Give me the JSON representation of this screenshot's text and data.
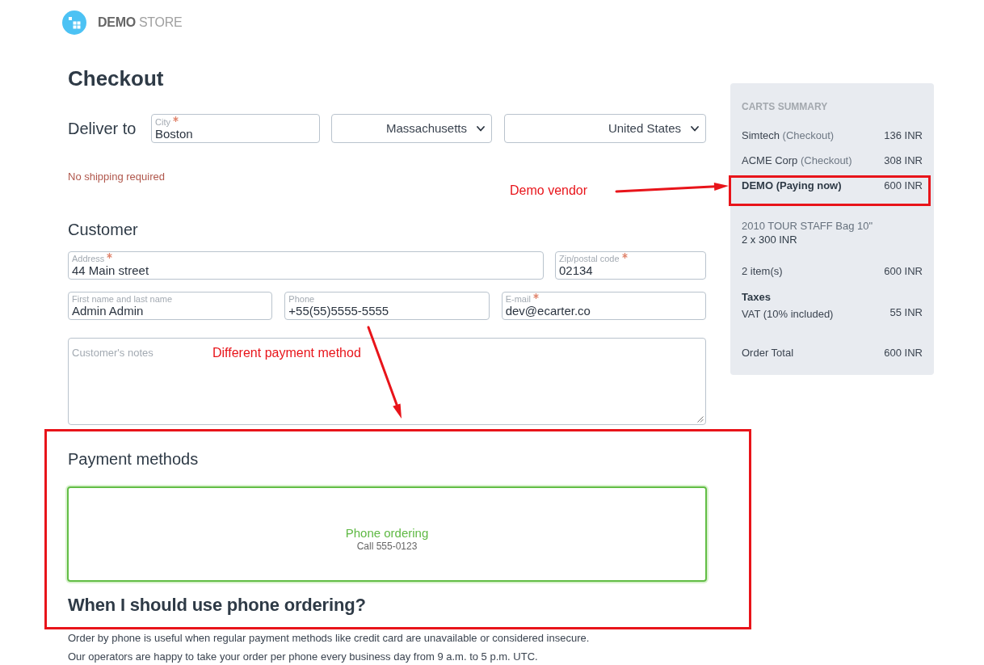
{
  "header": {
    "logo_text": "**DEMO** STORE"
  },
  "page_title": "Checkout",
  "delivery": {
    "label": "Deliver to",
    "city": {
      "label": "City",
      "required": true,
      "value": "Boston"
    },
    "state": {
      "value": "Massachusetts"
    },
    "country": {
      "value": "United States"
    },
    "shipping_note": "No shipping required"
  },
  "customer": {
    "title": "Customer",
    "rows": [
      [
        {
          "label": "Address",
          "required": true,
          "value": "44 Main street"
        },
        {
          "label": "Zip/postal code",
          "required": true,
          "value": "02134"
        }
      ],
      [
        {
          "label": "First name and last name",
          "required": false,
          "value": "Admin Admin"
        },
        {
          "label": "Phone",
          "required": false,
          "value": "+55(55)5555-5555"
        },
        {
          "label": "E-mail",
          "required": true,
          "value": "dev@ecarter.co"
        }
      ]
    ],
    "notes": {
      "placeholder": "Customer's notes"
    }
  },
  "payment": {
    "title": "Payment methods",
    "methods": [
      {
        "name": "Phone ordering",
        "description": "Call 555-0123",
        "selected": true
      }
    ],
    "info_title": "When I should use phone ordering?",
    "info_paragraphs": [
      "Order by phone is useful when regular payment methods like credit card are unavailable or considered insecure.",
      "Our operators are happy to take your order per phone every business day from 9 a.m. to 5 p.m. UTC."
    ]
  },
  "carts_summary": {
    "title": "CARTS SUMMARY",
    "vendors": [
      {
        "name": "Simtech",
        "status": "(Checkout)",
        "total": "136 INR",
        "selected": false
      },
      {
        "name": "ACME Corp",
        "status": "(Checkout)",
        "total": "308 INR",
        "selected": false
      },
      {
        "name": "DEMO",
        "status": "(Paying now)",
        "total": "600 INR",
        "selected": true
      }
    ],
    "items": [
      {
        "name": "2010 TOUR STAFF Bag 10\"",
        "quantity_price": "2 x 300 INR"
      }
    ],
    "subtotal": {
      "label": "2 item(s)",
      "value": "600 INR"
    },
    "taxes": {
      "title": "Taxes",
      "rows": [
        {
          "label": "VAT (10% included)",
          "value": "55 INR"
        }
      ]
    },
    "order_total": {
      "label": "Order Total",
      "value": "600 INR"
    }
  },
  "annotations": [
    {
      "text": "Demo vendor"
    },
    {
      "text": "Different payment method"
    }
  ]
}
